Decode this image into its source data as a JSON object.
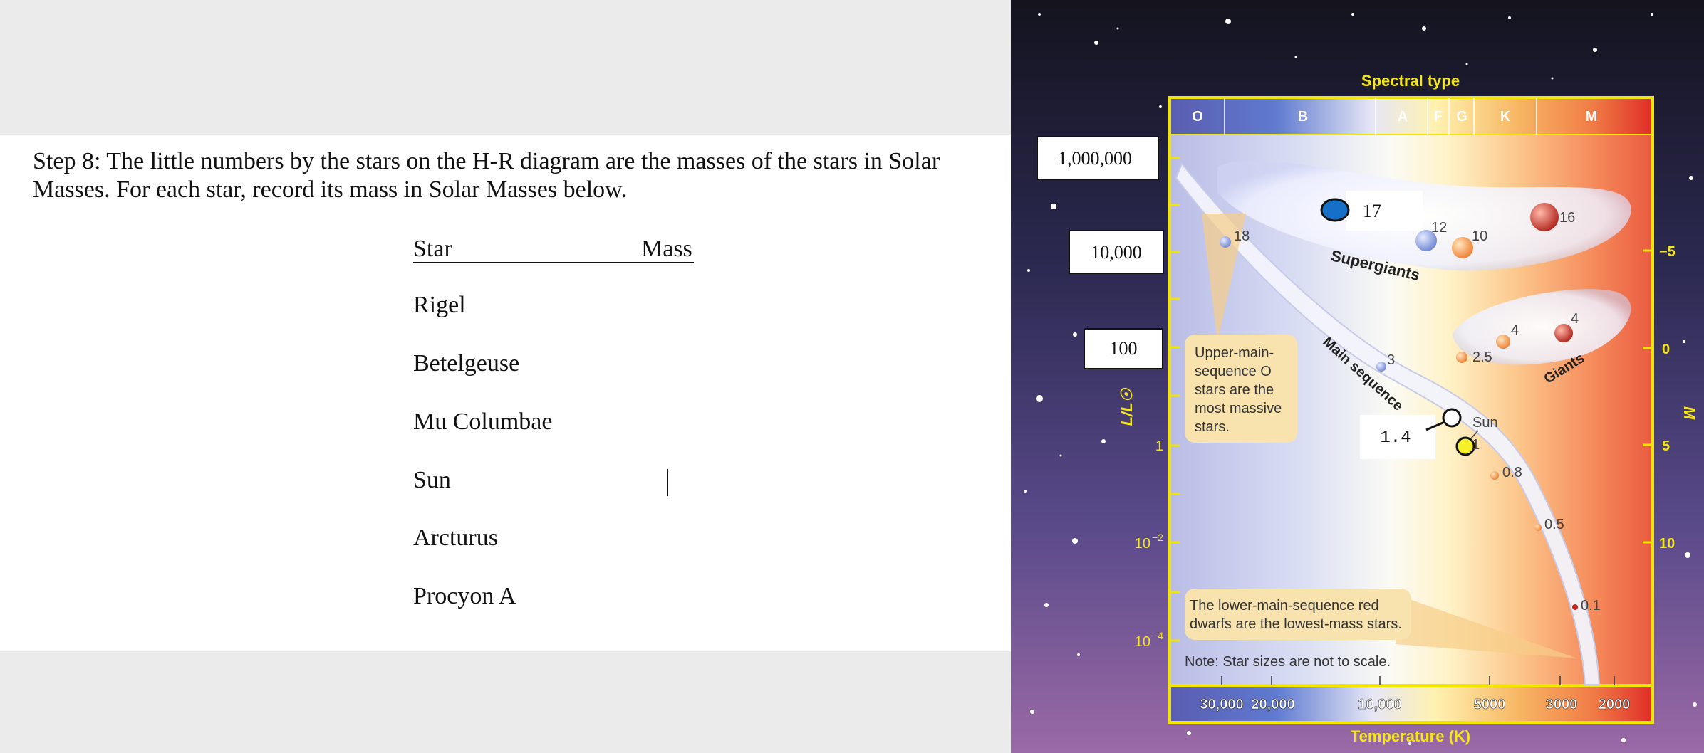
{
  "worksheet": {
    "step_text": "Step 8:  The little numbers by the stars on the H-R diagram are the masses of the stars in Solar Masses. For each star, record its mass in Solar Masses below.",
    "col_star": "Star",
    "col_mass": "Mass",
    "stars": [
      "Rigel",
      "Betelgeuse",
      "Mu Columbae",
      "Sun",
      "Arcturus",
      "Procyon A"
    ]
  },
  "diagram": {
    "title_spectral": "Spectral type",
    "spectral_types": [
      "O",
      "B",
      "A",
      "F",
      "G",
      "K",
      "M"
    ],
    "lum_boxes": [
      "1,000,000",
      "10,000",
      "100"
    ],
    "lum_ticks": [
      "1",
      "10",
      "−2",
      "10",
      "−4"
    ],
    "y_label_left": "L/L☉",
    "y_label_right": "M",
    "mag_ticks": [
      "−5",
      "0",
      "5",
      "10"
    ],
    "temp_ticks": [
      "30,000",
      "20,000",
      "10,000",
      "5000",
      "3000",
      "2000"
    ],
    "temp_label": "Temperature (K)",
    "regions": {
      "supergiants": "Supergiants",
      "main_sequence": "Main sequence",
      "giants": "Giants"
    },
    "note_upper": [
      "Upper-main-",
      "sequence O",
      "stars are the",
      "most massive",
      "stars."
    ],
    "note_lower": [
      "The lower-main-sequence red",
      "dwarfs are the lowest-mass stars."
    ],
    "note_scale": "Note: Star sizes are not to scale.",
    "mass_labels": {
      "m18": "18",
      "m17": "17",
      "m12": "12",
      "m10": "10",
      "m16": "16",
      "m4a": "4",
      "m4b": "4",
      "m25": "2.5",
      "m3": "3",
      "m14": "1.4",
      "m1": "1",
      "m08": "0.8",
      "m05": "0.5",
      "m01": "0.1"
    },
    "sun_label": "Sun",
    "colors": {
      "frame_yellow": "#f2e600",
      "spectral_title": "#f5e61a",
      "temp_label": "#f5e61a"
    }
  }
}
